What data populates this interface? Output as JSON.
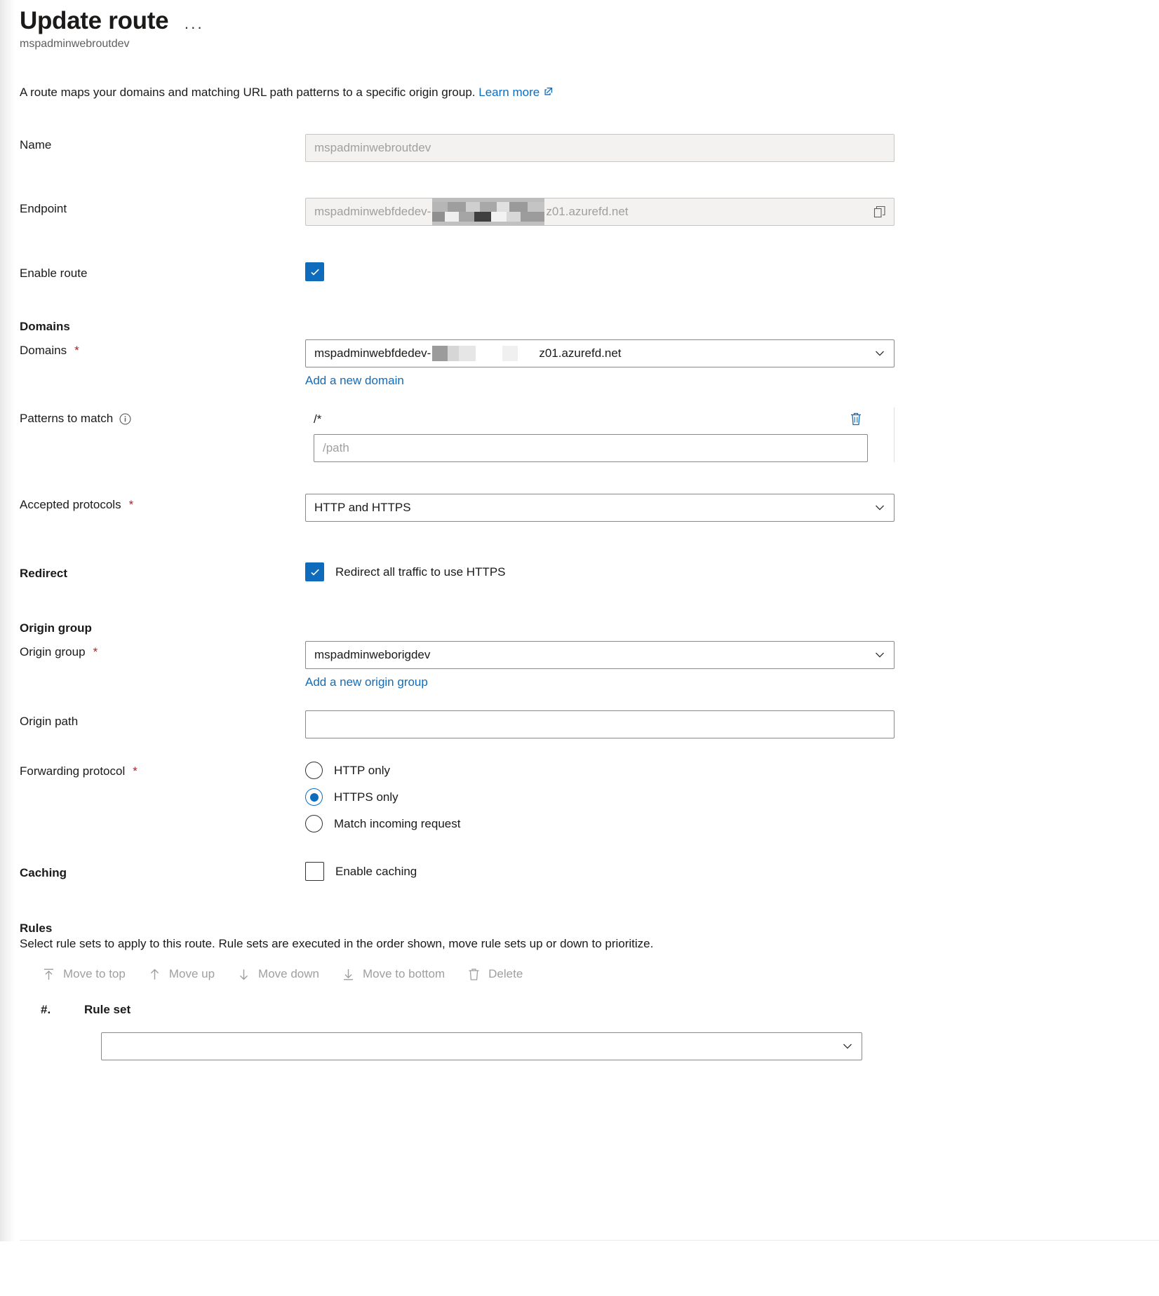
{
  "header": {
    "title": "Update route",
    "subtitle": "mspadminwebroutdev",
    "more_label": "···"
  },
  "description": {
    "text": "A route maps your domains and matching URL path patterns to a specific origin group.",
    "link_label": "Learn more"
  },
  "fields": {
    "name": {
      "label": "Name",
      "value": "mspadminwebroutdev"
    },
    "endpoint": {
      "label": "Endpoint",
      "value_prefix": "mspadminwebfdedev-",
      "value_suffix": "z01.azurefd.net"
    },
    "enable_route": {
      "label": "Enable route",
      "checked": true
    }
  },
  "domains_section": {
    "heading": "Domains",
    "label": "Domains",
    "required": "*",
    "value_prefix": "mspadminwebfdedev-",
    "value_suffix": "z01.azurefd.net",
    "add_link": "Add a new domain"
  },
  "patterns": {
    "label": "Patterns to match",
    "info_icon": "info-icon",
    "existing": "/*",
    "input_placeholder": "/path"
  },
  "protocols": {
    "label": "Accepted protocols",
    "required": "*",
    "value": "HTTP and HTTPS"
  },
  "redirect": {
    "heading": "Redirect",
    "checkbox_label": "Redirect all traffic to use HTTPS",
    "checked": true
  },
  "origin_group": {
    "heading": "Origin group",
    "label": "Origin group",
    "required": "*",
    "value": "mspadminweborigdev",
    "add_link": "Add a new origin group",
    "path_label": "Origin path",
    "path_value": ""
  },
  "forwarding": {
    "label": "Forwarding protocol",
    "required": "*",
    "options": [
      {
        "label": "HTTP only",
        "selected": false
      },
      {
        "label": "HTTPS only",
        "selected": true
      },
      {
        "label": "Match incoming request",
        "selected": false
      }
    ]
  },
  "caching": {
    "heading": "Caching",
    "checkbox_label": "Enable caching",
    "checked": false
  },
  "rules": {
    "heading": "Rules",
    "description": "Select rule sets to apply to this route. Rule sets are executed in the order shown, move rule sets up or down to prioritize.",
    "toolbar": [
      {
        "label": "Move to top",
        "icon": "move-to-top-icon"
      },
      {
        "label": "Move up",
        "icon": "move-up-icon"
      },
      {
        "label": "Move down",
        "icon": "move-down-icon"
      },
      {
        "label": "Move to bottom",
        "icon": "move-to-bottom-icon"
      },
      {
        "label": "Delete",
        "icon": "delete-icon"
      }
    ],
    "columns": [
      "#.",
      "Rule set"
    ],
    "row_value": ""
  },
  "colors": {
    "accent": "#0f6cbd",
    "link": "#0f6cbd",
    "required": "#a4262c",
    "disabled_bg": "#f3f2f1",
    "border": "#8a8886",
    "text": "#1b1a19",
    "muted": "#605e5c"
  }
}
